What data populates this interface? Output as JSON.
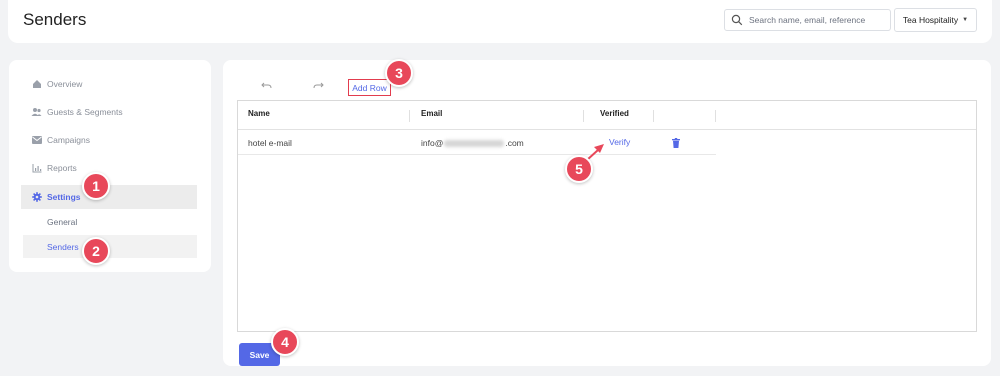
{
  "header": {
    "title": "Senders",
    "search_placeholder": "Search name, email, reference",
    "org_name": "Tea Hospitality"
  },
  "sidebar": {
    "items": [
      {
        "label": "Overview",
        "icon": "home-icon"
      },
      {
        "label": "Guests & Segments",
        "icon": "users-icon"
      },
      {
        "label": "Campaigns",
        "icon": "mail-icon"
      },
      {
        "label": "Reports",
        "icon": "chart-icon"
      },
      {
        "label": "Settings",
        "icon": "gear-icon"
      }
    ],
    "sub_items": [
      {
        "label": "General"
      },
      {
        "label": "Senders"
      }
    ]
  },
  "toolbar": {
    "undo_icon": "undo-icon",
    "redo_icon": "redo-icon",
    "add_row_label": "Add Row"
  },
  "table": {
    "columns": [
      "Name",
      "Email",
      "Verified"
    ],
    "rows": [
      {
        "name": "hotel e-mail",
        "email_prefix": "info@",
        "email_suffix": ".com",
        "verify_label": "Verify"
      }
    ]
  },
  "save_label": "Save",
  "annotations": [
    "1",
    "2",
    "3",
    "4",
    "5"
  ],
  "colors": {
    "accent": "#5468e6",
    "marker": "#e8485a"
  }
}
